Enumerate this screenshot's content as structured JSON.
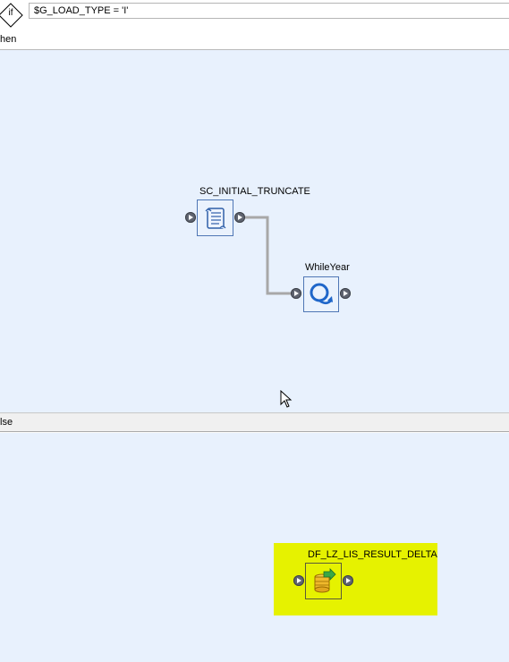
{
  "if_block": {
    "keyword": "if",
    "condition": "$G_LOAD_TYPE = 'I'"
  },
  "then_section": {
    "label": "hen",
    "nodes": [
      {
        "name": "SC_INITIAL_TRUNCATE",
        "type": "script",
        "icon": "script-icon"
      },
      {
        "name": "WhileYear",
        "type": "while-loop",
        "icon": "while-loop-icon"
      }
    ],
    "connection": {
      "from": "SC_INITIAL_TRUNCATE",
      "to": "WhileYear"
    }
  },
  "else_section": {
    "label": "lse",
    "nodes": [
      {
        "name": "DF_LZ_LIS_RESULT_DELTA",
        "type": "dataflow",
        "icon": "dataflow-icon",
        "highlighted": true
      }
    ]
  },
  "colors": {
    "canvas": "#e8f1fd",
    "highlight": "#e6f200",
    "connector": "#a8a8a8",
    "node_border": "#4f76b5"
  }
}
